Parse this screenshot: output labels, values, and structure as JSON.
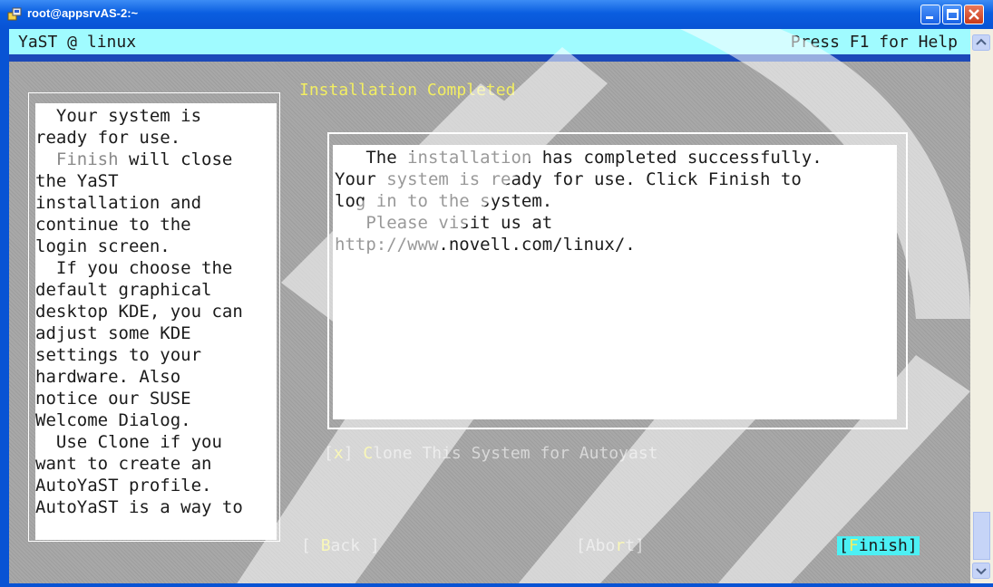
{
  "window": {
    "title": "root@appsrvAS-2:~",
    "icon": "terminal-icon",
    "controls": [
      "minimize-icon",
      "maximize-icon",
      "close-icon"
    ]
  },
  "header": {
    "title": "YaST @ linux",
    "help": "Press F1 for Help"
  },
  "heading": "Installation Completed",
  "help_pane": {
    "lines": [
      "  Your system is",
      "ready for use.",
      "  Finish will close",
      "the YaST",
      "installation and",
      "continue to the",
      "login screen.",
      "  If you choose the",
      "default graphical",
      "desktop KDE, you can",
      "adjust some KDE",
      "settings to your",
      "hardware. Also",
      "notice our SUSE",
      "Welcome Dialog.",
      "  Use Clone if you",
      "want to create an",
      "AutoYaST profile.",
      "AutoYaST is a way to"
    ],
    "highlight_finish": "Finish",
    "highlight_clone": "Clone"
  },
  "message": {
    "lines": [
      "   The installation has completed successfully.",
      "Your system is ready for use. Click Finish to",
      "log in to the system.",
      "   Please visit us at",
      "http://www.novell.com/linux/."
    ]
  },
  "checkbox": {
    "open": "[",
    "mark": "x",
    "close": "] ",
    "hotkey": "C",
    "label_rest": "lone This System for Autoyast"
  },
  "buttons": {
    "back": {
      "pre": "[ ",
      "hotkey": "B",
      "post": "ack ]"
    },
    "abort": {
      "pre": "[Abo",
      "hotkey": "r",
      "post": "t]"
    },
    "finish": {
      "pre": "[",
      "hotkey": "F",
      "post": "inish]"
    }
  },
  "colors": {
    "title_bar": "#0a5ee0",
    "header_bar": "#a0fbff",
    "terminal_bg": "#a8a8a8",
    "heading": "#f2ee62",
    "hotkey": "#f2ee62",
    "finish_bg": "#4cf0f4"
  }
}
